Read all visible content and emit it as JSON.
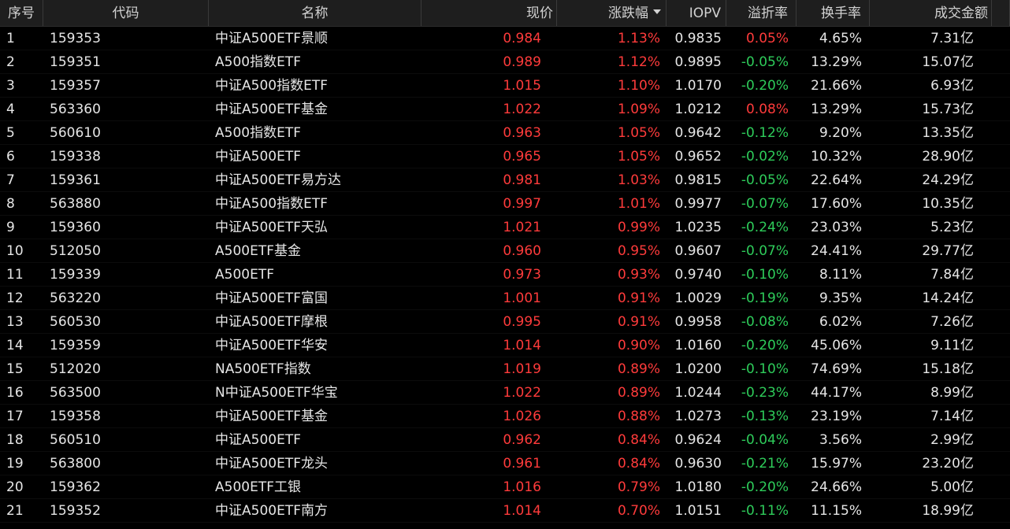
{
  "colors": {
    "up": "#ff3b3b",
    "down": "#2ecc5a",
    "text": "#e6e6e6",
    "header_bg": "#1e1e1e",
    "background": "#000000"
  },
  "headers": {
    "idx": "序号",
    "code": "代码",
    "name": "名称",
    "price": "现价",
    "change": "涨跌幅",
    "iopv": "IOPV",
    "premium": "溢折率",
    "turnover": "换手率",
    "amount": "成交金额"
  },
  "sort": {
    "column": "change",
    "direction": "desc",
    "icon": "sort-down-icon"
  },
  "rows": [
    {
      "idx": "1",
      "code": "159353",
      "name": "中证A500ETF景顺",
      "price": "0.984",
      "change": "1.13%",
      "iopv": "0.9835",
      "premium": "0.05%",
      "premium_dir": "up",
      "turnover": "4.65%",
      "amount": "7.31亿"
    },
    {
      "idx": "2",
      "code": "159351",
      "name": "A500指数ETF",
      "price": "0.989",
      "change": "1.12%",
      "iopv": "0.9895",
      "premium": "-0.05%",
      "premium_dir": "down",
      "turnover": "13.29%",
      "amount": "15.07亿"
    },
    {
      "idx": "3",
      "code": "159357",
      "name": "中证A500指数ETF",
      "price": "1.015",
      "change": "1.10%",
      "iopv": "1.0170",
      "premium": "-0.20%",
      "premium_dir": "down",
      "turnover": "21.66%",
      "amount": "6.93亿"
    },
    {
      "idx": "4",
      "code": "563360",
      "name": "中证A500ETF基金",
      "price": "1.022",
      "change": "1.09%",
      "iopv": "1.0212",
      "premium": "0.08%",
      "premium_dir": "up",
      "turnover": "13.29%",
      "amount": "15.73亿"
    },
    {
      "idx": "5",
      "code": "560610",
      "name": "A500指数ETF",
      "price": "0.963",
      "change": "1.05%",
      "iopv": "0.9642",
      "premium": "-0.12%",
      "premium_dir": "down",
      "turnover": "9.20%",
      "amount": "13.35亿"
    },
    {
      "idx": "6",
      "code": "159338",
      "name": "中证A500ETF",
      "price": "0.965",
      "change": "1.05%",
      "iopv": "0.9652",
      "premium": "-0.02%",
      "premium_dir": "down",
      "turnover": "10.32%",
      "amount": "28.90亿"
    },
    {
      "idx": "7",
      "code": "159361",
      "name": "中证A500ETF易方达",
      "price": "0.981",
      "change": "1.03%",
      "iopv": "0.9815",
      "premium": "-0.05%",
      "premium_dir": "down",
      "turnover": "22.64%",
      "amount": "24.29亿"
    },
    {
      "idx": "8",
      "code": "563880",
      "name": "中证A500指数ETF",
      "price": "0.997",
      "change": "1.01%",
      "iopv": "0.9977",
      "premium": "-0.07%",
      "premium_dir": "down",
      "turnover": "17.60%",
      "amount": "10.35亿"
    },
    {
      "idx": "9",
      "code": "159360",
      "name": "中证A500ETF天弘",
      "price": "1.021",
      "change": "0.99%",
      "iopv": "1.0235",
      "premium": "-0.24%",
      "premium_dir": "down",
      "turnover": "23.03%",
      "amount": "5.23亿"
    },
    {
      "idx": "10",
      "code": "512050",
      "name": "A500ETF基金",
      "price": "0.960",
      "change": "0.95%",
      "iopv": "0.9607",
      "premium": "-0.07%",
      "premium_dir": "down",
      "turnover": "24.41%",
      "amount": "29.77亿"
    },
    {
      "idx": "11",
      "code": "159339",
      "name": "A500ETF",
      "price": "0.973",
      "change": "0.93%",
      "iopv": "0.9740",
      "premium": "-0.10%",
      "premium_dir": "down",
      "turnover": "8.11%",
      "amount": "7.84亿"
    },
    {
      "idx": "12",
      "code": "563220",
      "name": "中证A500ETF富国",
      "price": "1.001",
      "change": "0.91%",
      "iopv": "1.0029",
      "premium": "-0.19%",
      "premium_dir": "down",
      "turnover": "9.35%",
      "amount": "14.24亿"
    },
    {
      "idx": "13",
      "code": "560530",
      "name": "中证A500ETF摩根",
      "price": "0.995",
      "change": "0.91%",
      "iopv": "0.9958",
      "premium": "-0.08%",
      "premium_dir": "down",
      "turnover": "6.02%",
      "amount": "7.26亿"
    },
    {
      "idx": "14",
      "code": "159359",
      "name": "中证A500ETF华安",
      "price": "1.014",
      "change": "0.90%",
      "iopv": "1.0160",
      "premium": "-0.20%",
      "premium_dir": "down",
      "turnover": "45.06%",
      "amount": "9.11亿"
    },
    {
      "idx": "15",
      "code": "512020",
      "name": "NA500ETF指数",
      "price": "1.019",
      "change": "0.89%",
      "iopv": "1.0200",
      "premium": "-0.10%",
      "premium_dir": "down",
      "turnover": "74.69%",
      "amount": "15.18亿"
    },
    {
      "idx": "16",
      "code": "563500",
      "name": "N中证A500ETF华宝",
      "price": "1.022",
      "change": "0.89%",
      "iopv": "1.0244",
      "premium": "-0.23%",
      "premium_dir": "down",
      "turnover": "44.17%",
      "amount": "8.99亿"
    },
    {
      "idx": "17",
      "code": "159358",
      "name": "中证A500ETF基金",
      "price": "1.026",
      "change": "0.88%",
      "iopv": "1.0273",
      "premium": "-0.13%",
      "premium_dir": "down",
      "turnover": "23.19%",
      "amount": "7.14亿"
    },
    {
      "idx": "18",
      "code": "560510",
      "name": "中证A500ETF",
      "price": "0.962",
      "change": "0.84%",
      "iopv": "0.9624",
      "premium": "-0.04%",
      "premium_dir": "down",
      "turnover": "3.56%",
      "amount": "2.99亿"
    },
    {
      "idx": "19",
      "code": "563800",
      "name": "中证A500ETF龙头",
      "price": "0.961",
      "change": "0.84%",
      "iopv": "0.9630",
      "premium": "-0.21%",
      "premium_dir": "down",
      "turnover": "15.97%",
      "amount": "23.20亿"
    },
    {
      "idx": "20",
      "code": "159362",
      "name": "A500ETF工银",
      "price": "1.016",
      "change": "0.79%",
      "iopv": "1.0180",
      "premium": "-0.20%",
      "premium_dir": "down",
      "turnover": "24.66%",
      "amount": "5.00亿"
    },
    {
      "idx": "21",
      "code": "159352",
      "name": "中证A500ETF南方",
      "price": "1.014",
      "change": "0.70%",
      "iopv": "1.0151",
      "premium": "-0.11%",
      "premium_dir": "down",
      "turnover": "11.15%",
      "amount": "18.99亿"
    }
  ]
}
